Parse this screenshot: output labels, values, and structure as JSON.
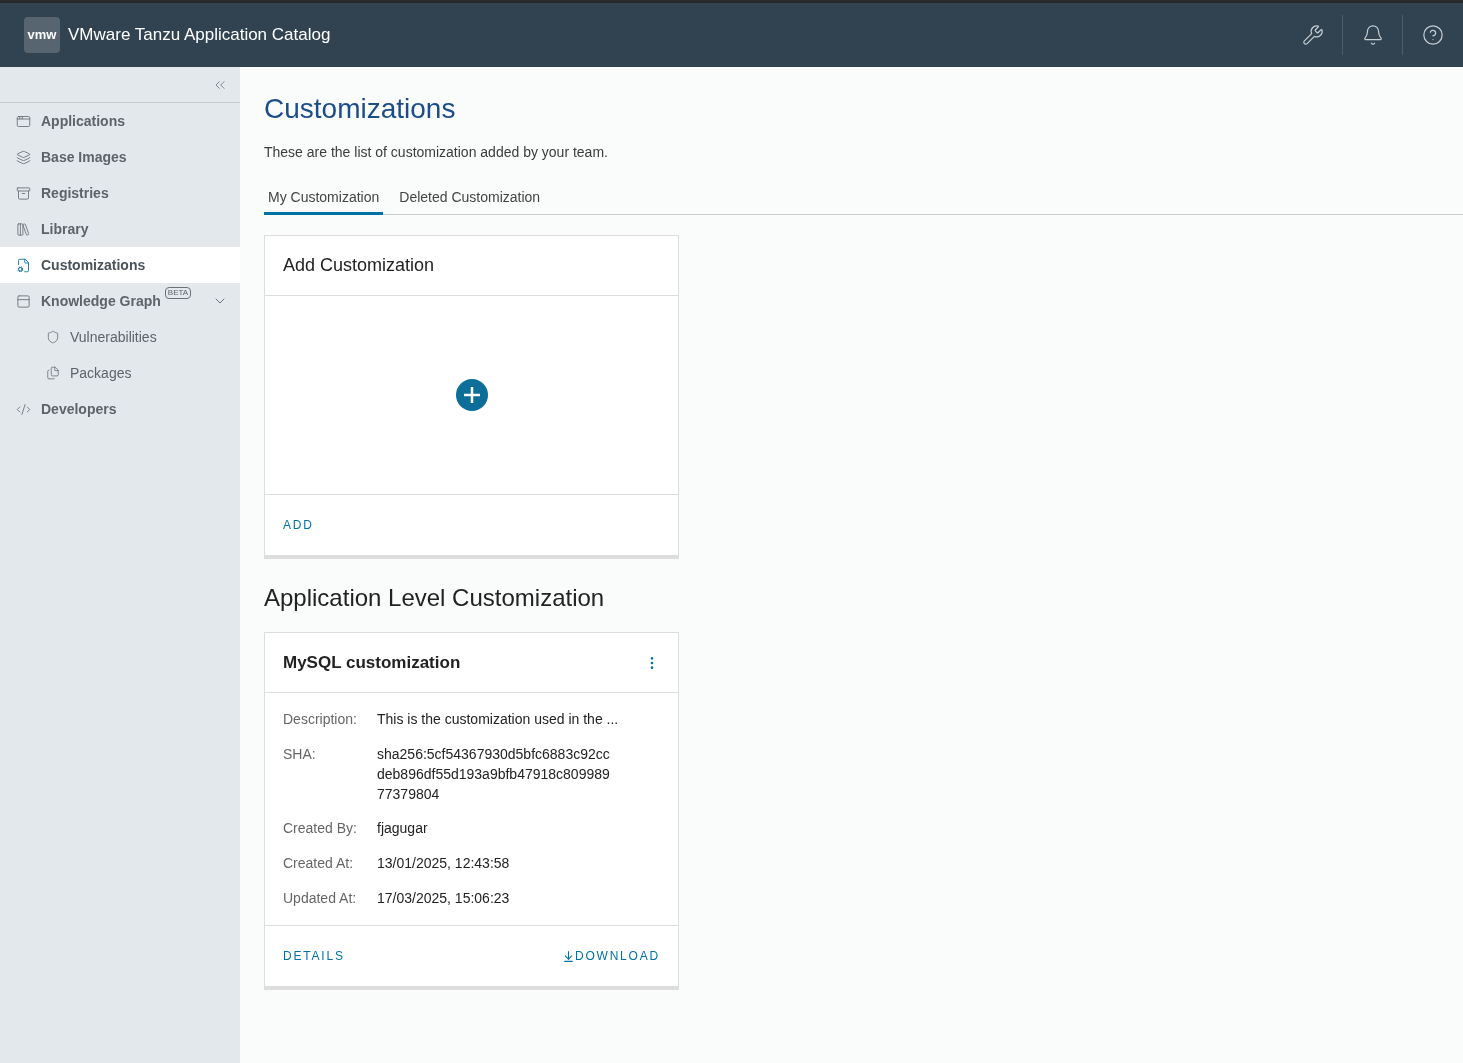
{
  "header": {
    "logo": "vmw",
    "title": "VMware Tanzu Application Catalog"
  },
  "sidebar": {
    "items": [
      {
        "label": "Applications",
        "selected": false
      },
      {
        "label": "Base Images",
        "selected": false
      },
      {
        "label": "Registries",
        "selected": false
      },
      {
        "label": "Library",
        "selected": false
      },
      {
        "label": "Customizations",
        "selected": true
      },
      {
        "label": "Knowledge Graph",
        "selected": false,
        "badge": "BETA",
        "expanded": true,
        "children": [
          {
            "label": "Vulnerabilities",
            "selected": false
          },
          {
            "label": "Packages",
            "selected": false
          }
        ]
      },
      {
        "label": "Developers",
        "selected": false
      }
    ]
  },
  "page": {
    "title": "Customizations",
    "subtitle": "These are the list of customization added by your team.",
    "tabs": [
      {
        "label": "My Customization",
        "selected": true
      },
      {
        "label": "Deleted Customization",
        "selected": false
      }
    ],
    "add_card": {
      "title": "Add Customization",
      "action": "ADD"
    },
    "section_title": "Application Level Customization",
    "cards": [
      {
        "title": "MySQL customization",
        "fields": [
          {
            "label": "Description:",
            "lines": [
              "This is the customization used in the ..."
            ]
          },
          {
            "label": "SHA:",
            "lines": [
              "sha256:5cf54367930d5bfc6883c92cc",
              "deb896df55d193a9bfb47918c809989",
              "77379804"
            ]
          },
          {
            "label": "Created By:",
            "lines": [
              "fjagugar"
            ]
          },
          {
            "label": "Created At:",
            "lines": [
              "13/01/2025, 12:43:58"
            ]
          },
          {
            "label": "Updated At:",
            "lines": [
              "17/03/2025, 15:06:23"
            ]
          }
        ],
        "actions": [
          "DETAILS",
          "DOWNLOAD"
        ]
      }
    ]
  }
}
